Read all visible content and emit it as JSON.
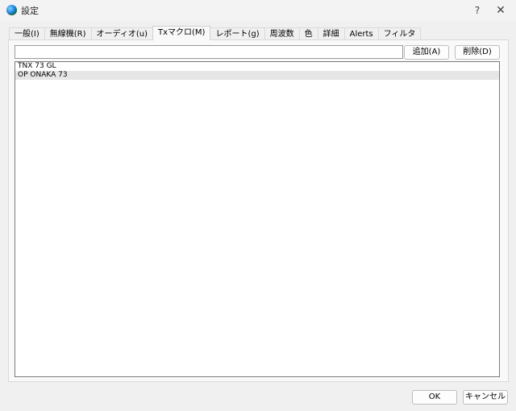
{
  "window": {
    "title": "設定",
    "help_label": "?",
    "close_label": "✕"
  },
  "tabs": [
    {
      "label": "一般(I)",
      "active": false
    },
    {
      "label": "無線機(R)",
      "active": false
    },
    {
      "label": "オーディオ(u)",
      "active": false
    },
    {
      "label": "Txマクロ(M)",
      "active": true
    },
    {
      "label": "レポート(g)",
      "active": false
    },
    {
      "label": "周波数",
      "active": false
    },
    {
      "label": "色",
      "active": false
    },
    {
      "label": "詳細",
      "active": false
    },
    {
      "label": "Alerts",
      "active": false
    },
    {
      "label": "フィルタ",
      "active": false
    }
  ],
  "macros": {
    "input_value": "",
    "add_label": "追加(A)",
    "delete_label": "削除(D)",
    "items": [
      "TNX 73 GL",
      "OP ONAKA 73"
    ],
    "selected_index": 1
  },
  "footer": {
    "ok_label": "OK",
    "cancel_label": "キャンセル"
  }
}
